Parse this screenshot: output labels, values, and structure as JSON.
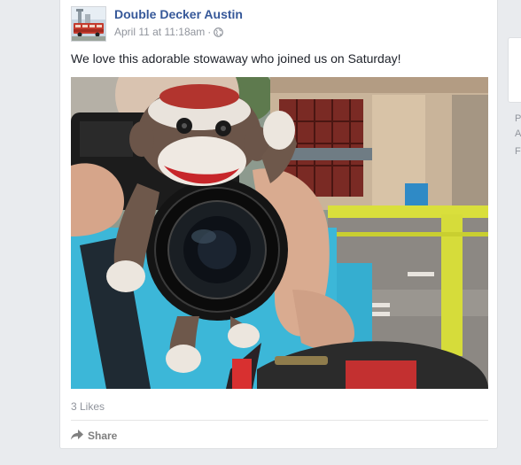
{
  "post": {
    "page_name": "Double Decker Austin",
    "timestamp": "April 11 at 11:18am",
    "separator": "·",
    "privacy_icon": "globe-icon",
    "text": "We love this adorable stowaway who joined us on Saturday!",
    "likes": "3 Likes",
    "share_label": "Share",
    "share_icon": "share-arrow-icon"
  },
  "sidebar": {
    "letters": [
      "P",
      "A",
      "F"
    ]
  },
  "colors": {
    "page_name": "#365899",
    "meta": "#90949c",
    "background": "#e9ebee",
    "card": "#ffffff"
  }
}
